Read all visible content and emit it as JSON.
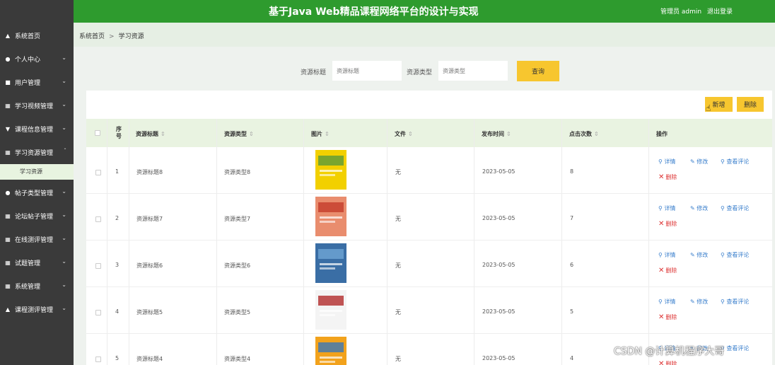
{
  "header": {
    "title": "基于Java Web精品课程网络平台的设计与实现",
    "user": "管理员 admin",
    "logout": "退出登录"
  },
  "sidebar": {
    "items": [
      {
        "label": "系统首页",
        "icon": "home-icon"
      },
      {
        "label": "个人中心",
        "icon": "user-icon"
      },
      {
        "label": "用户管理",
        "icon": "clipboard-icon"
      },
      {
        "label": "学习视频管理",
        "icon": "grid-icon"
      },
      {
        "label": "课程信息管理",
        "icon": "book-icon"
      },
      {
        "label": "学习资源管理",
        "icon": "grid-icon"
      },
      {
        "label": "帖子类型管理",
        "icon": "user-icon"
      },
      {
        "label": "论坛帖子管理",
        "icon": "grid-icon"
      },
      {
        "label": "在线测评管理",
        "icon": "grid-icon"
      },
      {
        "label": "试题管理",
        "icon": "grid-icon"
      },
      {
        "label": "系统管理",
        "icon": "grid-icon"
      },
      {
        "label": "课程测评管理",
        "icon": "graduation-icon"
      }
    ],
    "sub_active": "学习资源"
  },
  "breadcrumb": {
    "home": "系统首页",
    "separator": ">",
    "current": "学习资源"
  },
  "search": {
    "title_label": "资源标题",
    "title_placeholder": "资源标题",
    "type_label": "资源类型",
    "type_placeholder": "资源类型",
    "button": "查询"
  },
  "toolbar": {
    "add": "新增",
    "delete": "删除"
  },
  "table": {
    "headers": [
      "序号",
      "资源标题",
      "资源类型",
      "图片",
      "文件",
      "发布时间",
      "点击次数",
      "操作"
    ],
    "rows": [
      {
        "no": "1",
        "title": "资源标题8",
        "type": "资源类型8",
        "file": "无",
        "date": "2023-05-05",
        "clicks": "8"
      },
      {
        "no": "2",
        "title": "资源标题7",
        "type": "资源类型7",
        "file": "无",
        "date": "2023-05-05",
        "clicks": "7"
      },
      {
        "no": "3",
        "title": "资源标题6",
        "type": "资源类型6",
        "file": "无",
        "date": "2023-05-05",
        "clicks": "6"
      },
      {
        "no": "4",
        "title": "资源标题5",
        "type": "资源类型5",
        "file": "无",
        "date": "2023-05-05",
        "clicks": "5"
      },
      {
        "no": "5",
        "title": "资源标题4",
        "type": "资源类型4",
        "file": "无",
        "date": "2023-05-05",
        "clicks": "4"
      }
    ],
    "actions": {
      "detail": "详情",
      "edit": "修改",
      "comments": "查看评论",
      "delete": "删除"
    }
  },
  "watermark": "CSDN @计算机程序大哥",
  "colors": {
    "header_green": "#2e9b2e",
    "sidebar_dark": "#3a3a3a",
    "button_yellow": "#f7c62f",
    "link_blue": "#3a7fcc",
    "delete_red": "#d33333"
  }
}
